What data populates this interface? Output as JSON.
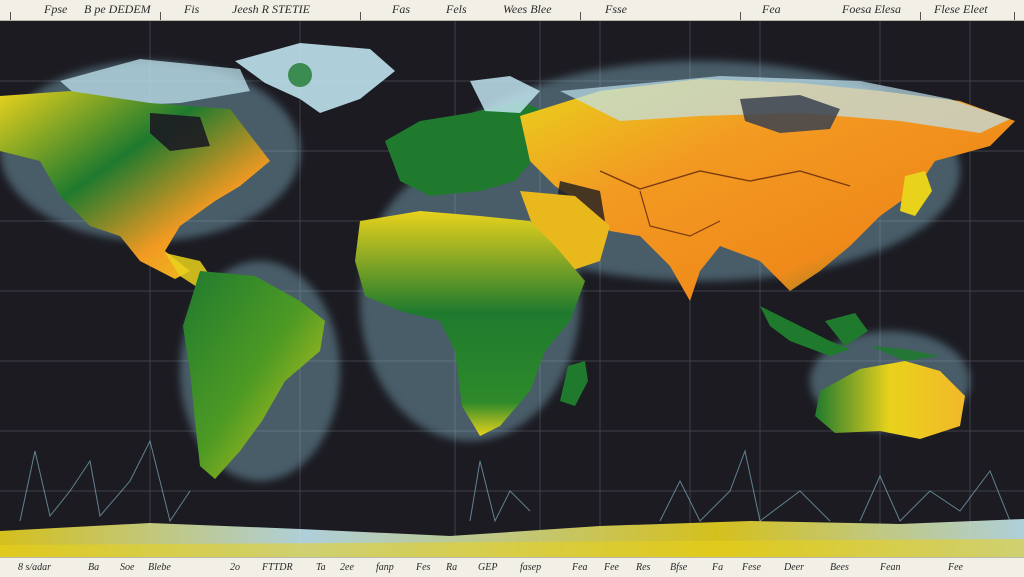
{
  "header_labels": [
    "Fpse",
    "B pe DEDEM",
    "Fis",
    "Jeesh R STETIE",
    "Fas",
    "Fels",
    "Wees Blee",
    "Fsse",
    "Fea",
    "Foesa Elesa",
    "Flese Eleet"
  ],
  "footer_labels": [
    "8 s/adar",
    "Ba",
    "Soe",
    "Blebe",
    "2o",
    "FTTDR",
    "Ta",
    "2ee",
    "fanp",
    "Fes",
    "Ra",
    "GEP",
    "fasep",
    "Fea",
    "Fee",
    "Res",
    "Bfse",
    "Fa",
    "Fese",
    "Deer",
    "Bees",
    "Fean",
    "Fee"
  ],
  "colors": {
    "background": "#1c1b22",
    "ocean_grid": "#5a5d6a",
    "land_green": "#1f7a2e",
    "land_yellow": "#e9d21c",
    "land_orange": "#f29a22",
    "ice": "#bfe3ee",
    "glow": "#9ad7ea"
  },
  "regions": [
    "north-america",
    "greenland",
    "south-america",
    "europe",
    "asia",
    "africa",
    "madagascar",
    "australia",
    "japan",
    "indonesia",
    "antarctica"
  ]
}
